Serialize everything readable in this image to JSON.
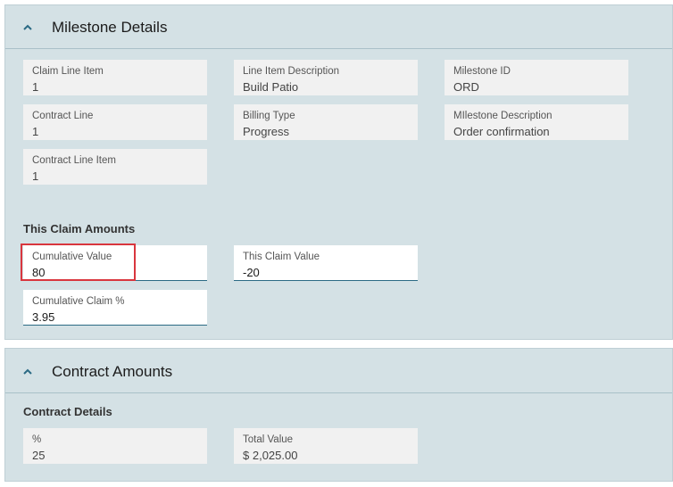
{
  "milestone": {
    "title": "Milestone Details",
    "fields": {
      "claim_line_item": {
        "label": "Claim Line Item",
        "value": "1"
      },
      "line_item_description": {
        "label": "Line Item Description",
        "value": "Build Patio"
      },
      "milestone_id": {
        "label": "Milestone ID",
        "value": "ORD"
      },
      "contract_line": {
        "label": "Contract Line",
        "value": "1"
      },
      "billing_type": {
        "label": "Billing Type",
        "value": "Progress"
      },
      "milestone_description": {
        "label": "MIlestone Description",
        "value": "Order confirmation"
      },
      "contract_line_item": {
        "label": "Contract Line Item",
        "value": "1"
      }
    },
    "claim_amounts": {
      "heading": "This Claim Amounts",
      "cumulative_value": {
        "label": "Cumulative Value",
        "value": "80"
      },
      "this_claim_value": {
        "label": "This Claim Value",
        "value": "-20"
      },
      "cumulative_claim_pct": {
        "label": "Cumulative Claim %",
        "value": "3.95"
      }
    }
  },
  "contract": {
    "title": "Contract Amounts",
    "details_heading": "Contract Details",
    "percent": {
      "label": "%",
      "value": "25"
    },
    "total_value": {
      "label": "Total Value",
      "currency": "$",
      "value": "2,025.00"
    }
  },
  "colors": {
    "section_bg": "#d4e1e5",
    "accent": "#2b6a84",
    "highlight": "#d9363e"
  },
  "icons": {
    "collapse": "chevron-up-icon"
  }
}
